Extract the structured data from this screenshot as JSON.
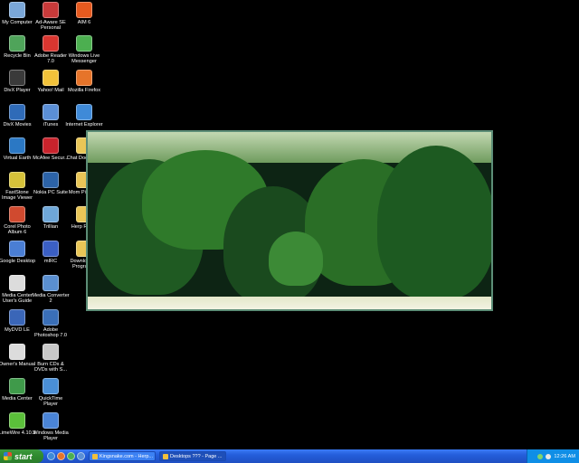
{
  "desktop_icons": [
    {
      "label": "My Computer",
      "icon": "computer-icon",
      "color": "#7aa7d8"
    },
    {
      "label": "Ad-Aware SE Personal",
      "icon": "adaware-icon",
      "color": "#c83a3a"
    },
    {
      "label": "AIM 6",
      "icon": "aim-icon",
      "color": "#e65a1f"
    },
    {
      "label": "Recycle Bin",
      "icon": "recycle-bin-icon",
      "color": "#4fa45a"
    },
    {
      "label": "Adobe Reader 7.0",
      "icon": "adobe-reader-icon",
      "color": "#d93630"
    },
    {
      "label": "Windows Live Messenger",
      "icon": "messenger-icon",
      "color": "#4caf50"
    },
    {
      "label": "DivX Player",
      "icon": "divx-icon",
      "color": "#3a3a3a"
    },
    {
      "label": "Yahoo! Mail",
      "icon": "yahoo-mail-icon",
      "color": "#f2c23a"
    },
    {
      "label": "Mozilla Firefox",
      "icon": "firefox-icon",
      "color": "#e6742a"
    },
    {
      "label": "DivX Movies",
      "icon": "divx-movies-icon",
      "color": "#2f6bb8"
    },
    {
      "label": "iTunes",
      "icon": "itunes-icon",
      "color": "#5b8fd6"
    },
    {
      "label": "Internet Explorer",
      "icon": "internet-explorer-icon",
      "color": "#3f8ad8"
    },
    {
      "label": "Virtual Earth",
      "icon": "virtual-earth-icon",
      "color": "#2b78c4"
    },
    {
      "label": "McAfee Secur...",
      "icon": "mcafee-icon",
      "color": "#c8232c"
    },
    {
      "label": "Chat Docume...",
      "icon": "folder-icon",
      "color": "#e9c657"
    },
    {
      "label": "FastStone Image Viewer",
      "icon": "faststone-icon",
      "color": "#d6c23a"
    },
    {
      "label": "Nokia PC Suite",
      "icon": "nokia-icon",
      "color": "#2c63a8"
    },
    {
      "label": "Mom Pictures",
      "icon": "folder-icon",
      "color": "#e9c657"
    },
    {
      "label": "Corel Photo Album 6",
      "icon": "corel-icon",
      "color": "#d04a2f"
    },
    {
      "label": "Trillian",
      "icon": "trillian-icon",
      "color": "#6fa7d8"
    },
    {
      "label": "Herp Room",
      "icon": "folder-icon",
      "color": "#e9c657"
    },
    {
      "label": "Google Desktop",
      "icon": "google-desktop-icon",
      "color": "#4a7ed4"
    },
    {
      "label": "mIRC",
      "icon": "mirc-icon",
      "color": "#3b5fc4"
    },
    {
      "label": "Downloaded Program...",
      "icon": "folder-icon",
      "color": "#e9c657"
    },
    {
      "label": "Media Center User's Guide",
      "icon": "media-center-guide-icon",
      "color": "#dcdcdc"
    },
    {
      "label": "Media Converter 2",
      "icon": "media-converter-icon",
      "color": "#5a8fd0"
    },
    {
      "label": "MyDVD LE",
      "icon": "mydvd-icon",
      "color": "#3a66b8"
    },
    {
      "label": "Adobe Photoshop 7.0",
      "icon": "photoshop-icon",
      "color": "#3a6fb8"
    },
    {
      "label": "Owner's Manual",
      "icon": "manual-icon",
      "color": "#dcdcdc"
    },
    {
      "label": "Burn CDs & DVDs with S...",
      "icon": "burn-cd-icon",
      "color": "#c8c8c8"
    },
    {
      "label": "Media Center",
      "icon": "media-center-icon",
      "color": "#3f9a4a"
    },
    {
      "label": "QuickTime Player",
      "icon": "quicktime-icon",
      "color": "#4a8fd6"
    },
    {
      "label": "LimeWire 4.10.3",
      "icon": "limewire-icon",
      "color": "#5bbf3a"
    },
    {
      "label": "Windows Media Player",
      "icon": "media-player-icon",
      "color": "#4a84d6"
    }
  ],
  "taskbar": {
    "start_label": "start",
    "tasks": [
      {
        "label": "Kingsnake.com - Herp..."
      },
      {
        "label": "Desktops ??? - Page ..."
      }
    ],
    "clock": "12:26 AM"
  },
  "colors": {
    "taskbar": "#245edb",
    "start": "#2f8a2f",
    "tray": "#0f8ee6",
    "desktop": "#000000"
  }
}
